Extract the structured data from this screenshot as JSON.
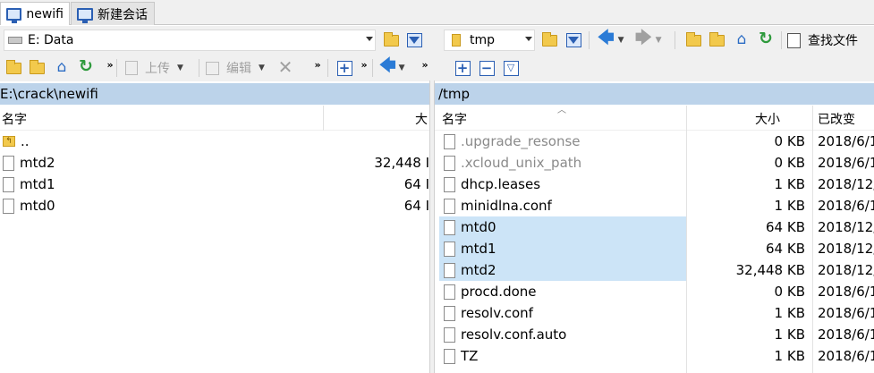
{
  "tabs": [
    {
      "label": "newifi"
    },
    {
      "label": "新建会话"
    }
  ],
  "left": {
    "drive_label": "E: Data",
    "toolbar": {
      "upload_label": "上传",
      "edit_label": "编辑"
    },
    "path": "E:\\crack\\newifi",
    "columns": {
      "name": "名字",
      "size": "大"
    },
    "rows": [
      {
        "name": "..",
        "size": ""
      },
      {
        "name": "mtd2",
        "size": "32,448 I"
      },
      {
        "name": "mtd1",
        "size": "64 I"
      },
      {
        "name": "mtd0",
        "size": "64 I"
      }
    ]
  },
  "right": {
    "dir_label": "tmp",
    "toolbar": {
      "find_files_label": "查找文件"
    },
    "path": "/tmp",
    "columns": {
      "name": "名字",
      "size": "大小",
      "modified": "已改变"
    },
    "rows": [
      {
        "name": ".upgrade_resonse",
        "size": "0 KB",
        "modified": "2018/6/1",
        "dim": true,
        "selected": false
      },
      {
        "name": ".xcloud_unix_path",
        "size": "0 KB",
        "modified": "2018/6/1",
        "dim": true,
        "selected": false
      },
      {
        "name": "dhcp.leases",
        "size": "1 KB",
        "modified": "2018/12/",
        "dim": false,
        "selected": false
      },
      {
        "name": "minidlna.conf",
        "size": "1 KB",
        "modified": "2018/6/1",
        "dim": false,
        "selected": false
      },
      {
        "name": "mtd0",
        "size": "64 KB",
        "modified": "2018/12/",
        "dim": false,
        "selected": true
      },
      {
        "name": "mtd1",
        "size": "64 KB",
        "modified": "2018/12/",
        "dim": false,
        "selected": true
      },
      {
        "name": "mtd2",
        "size": "32,448 KB",
        "modified": "2018/12/",
        "dim": false,
        "selected": true
      },
      {
        "name": "procd.done",
        "size": "0 KB",
        "modified": "2018/6/1",
        "dim": false,
        "selected": false
      },
      {
        "name": "resolv.conf",
        "size": "1 KB",
        "modified": "2018/6/1",
        "dim": false,
        "selected": false
      },
      {
        "name": "resolv.conf.auto",
        "size": "1 KB",
        "modified": "2018/6/1",
        "dim": false,
        "selected": false
      },
      {
        "name": "TZ",
        "size": "1 KB",
        "modified": "2018/6/1",
        "dim": false,
        "selected": false
      }
    ]
  },
  "colors": {
    "path_bar": "#bcd3ea",
    "selection": "#cce4f7",
    "accent": "#2b5fb3"
  }
}
